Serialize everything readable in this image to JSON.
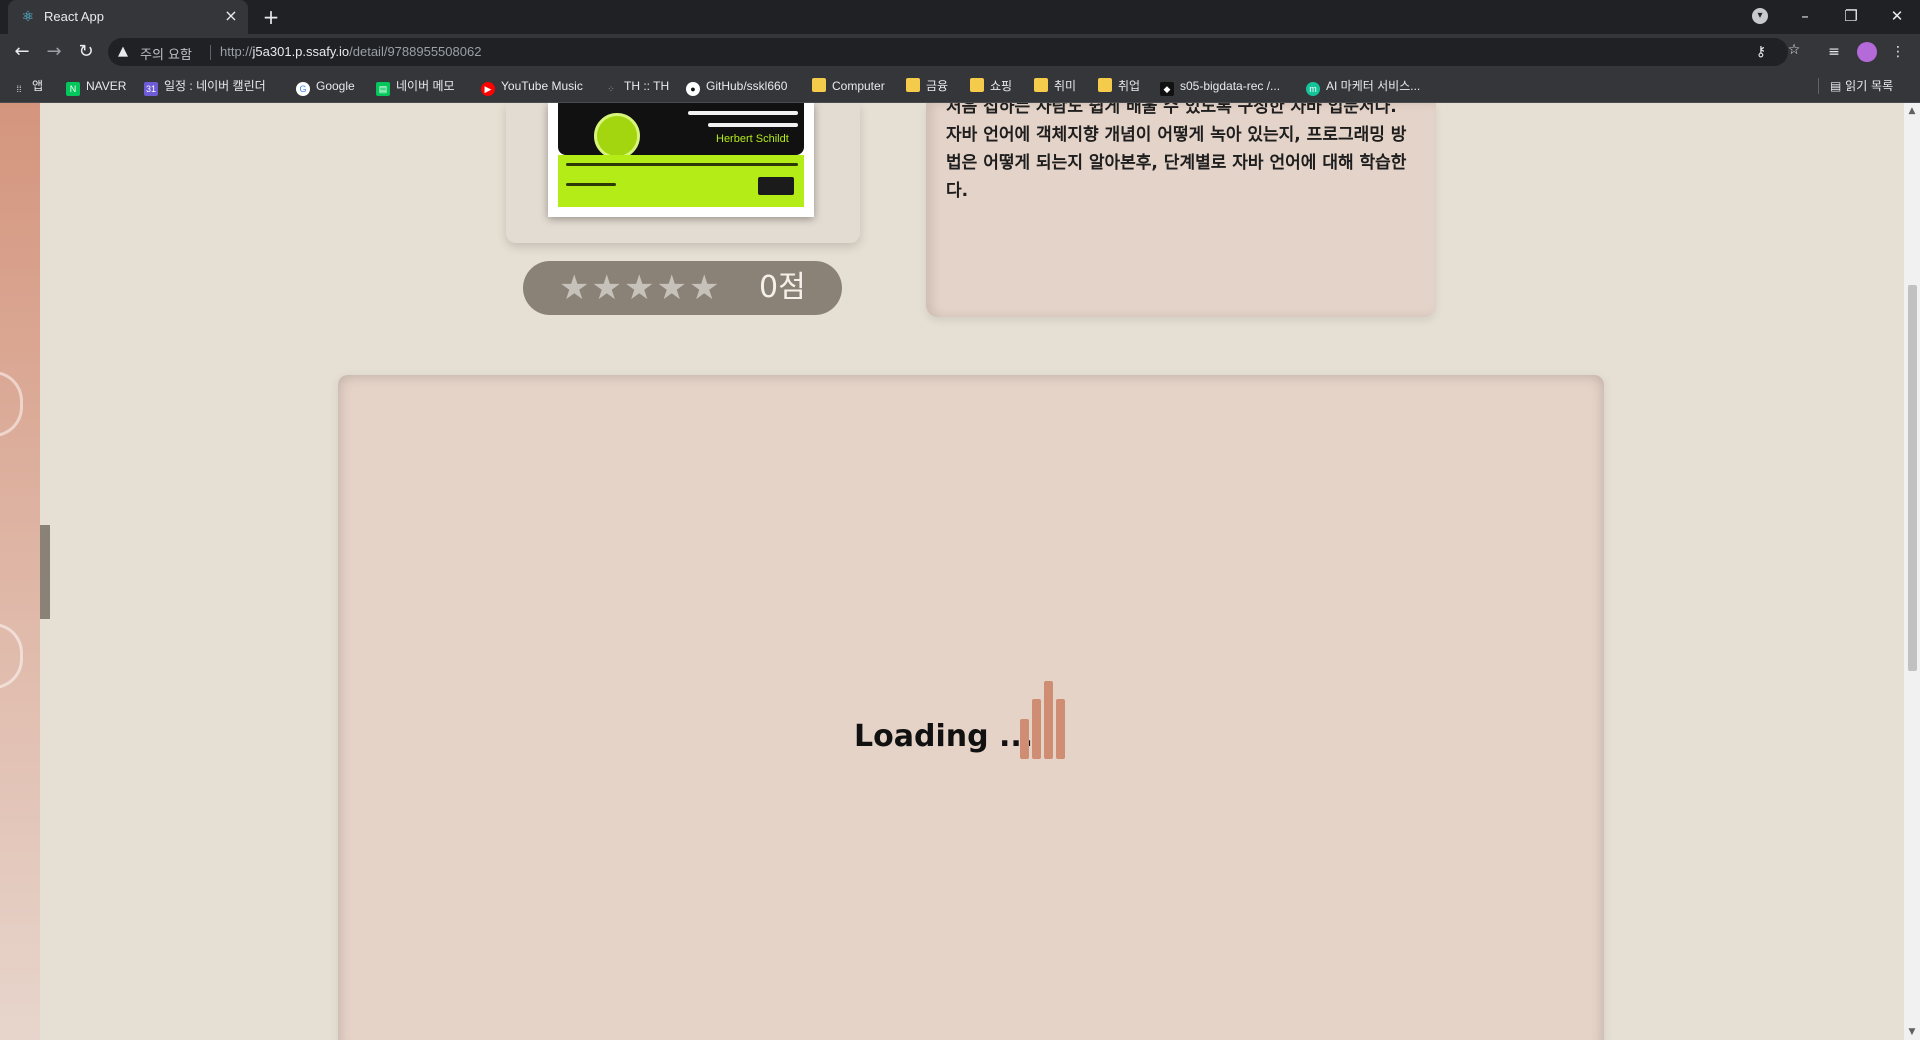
{
  "browser": {
    "tab_title": "React App",
    "security_label": "주의 요함",
    "url_prefix": "http://",
    "url_host": "j5a301.p.ssafy.io",
    "url_path": "/detail/9788955508062"
  },
  "bookmarks": [
    {
      "label": "앱",
      "icon": "apps-grid-icon",
      "color": "#e8eaed"
    },
    {
      "label": "NAVER",
      "icon": "naver-icon",
      "color": "#03c75a"
    },
    {
      "label": "일정 : 네이버 캘린더",
      "icon": "calendar-icon",
      "color": "#6e5bd6"
    },
    {
      "label": "Google",
      "icon": "google-icon",
      "color": "#ffffff"
    },
    {
      "label": "네이버 메모",
      "icon": "memo-icon",
      "color": "#03c75a"
    },
    {
      "label": "YouTube Music",
      "icon": "youtube-music-icon",
      "color": "#ff0000"
    },
    {
      "label": "TH :: TH",
      "icon": "dots-icon",
      "color": "#9aa0a6"
    },
    {
      "label": "GitHub/sskl660",
      "icon": "github-icon",
      "color": "#ffffff"
    },
    {
      "label": "Computer",
      "icon": "folder-icon",
      "color": "#f4cb4b"
    },
    {
      "label": "금융",
      "icon": "folder-icon",
      "color": "#f4cb4b"
    },
    {
      "label": "쇼핑",
      "icon": "folder-icon",
      "color": "#f4cb4b"
    },
    {
      "label": "취미",
      "icon": "folder-icon",
      "color": "#f4cb4b"
    },
    {
      "label": "취업",
      "icon": "folder-icon",
      "color": "#f4cb4b"
    },
    {
      "label": "s05-bigdata-rec /...",
      "icon": "gitlab-icon",
      "color": "#111111"
    },
    {
      "label": "AI 마케터 서비스...",
      "icon": "m-icon",
      "color": "#15c39a"
    }
  ],
  "reading_list": "읽기 목록",
  "book": {
    "author_on_cover": "Herbert Schildt",
    "rating_score": "0점",
    "rating_value": 0,
    "rating_max": 5,
    "description": "처음 접하는 사람도 쉽게 배울 수 있도록 구성한 자바 입문서다. 자바 언어에 객체지향 개념이 어떻게 녹아 있는지, 프로그래밍 방법은 어떻게 되는지 알아본후, 단계별로 자바 언어에 대해 학습한다."
  },
  "reviews": {
    "loading_text": "Loading ...",
    "accent_color": "#cf8d73"
  }
}
